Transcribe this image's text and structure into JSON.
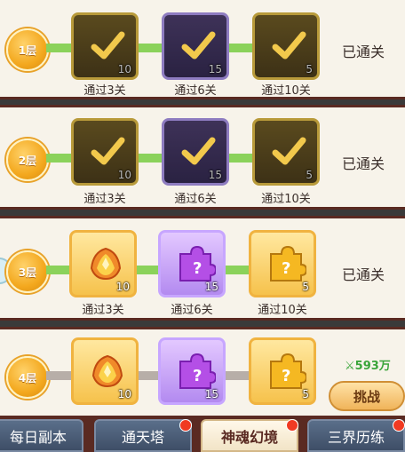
{
  "floors": [
    {
      "badge": "1层",
      "status": "已通关",
      "rewards": [
        {
          "label": "通过3关",
          "count": "10"
        },
        {
          "label": "通过6关",
          "count": "15"
        },
        {
          "label": "通过10关",
          "count": "5"
        }
      ]
    },
    {
      "badge": "2层",
      "status": "已通关",
      "rewards": [
        {
          "label": "通过3关",
          "count": "10"
        },
        {
          "label": "通过6关",
          "count": "15"
        },
        {
          "label": "通过10关",
          "count": "5"
        }
      ]
    },
    {
      "badge": "3层",
      "status": "已通关",
      "rewards": [
        {
          "label": "通过3关",
          "count": "10"
        },
        {
          "label": "通过6关",
          "count": "15"
        },
        {
          "label": "通过10关",
          "count": "5"
        }
      ]
    },
    {
      "badge": "4层",
      "power": "593万",
      "challenge": "挑战",
      "rewards": [
        {
          "count": "10"
        },
        {
          "count": "15"
        },
        {
          "count": "5"
        }
      ]
    }
  ],
  "tabs": [
    "每日副本",
    "通天塔",
    "神魂幻境",
    "三界历练"
  ],
  "colors": {
    "completed_track": "#8bd25b",
    "locked_track": "#b7aea8",
    "frame": "#5a2a22",
    "power": "#3aa53a"
  }
}
